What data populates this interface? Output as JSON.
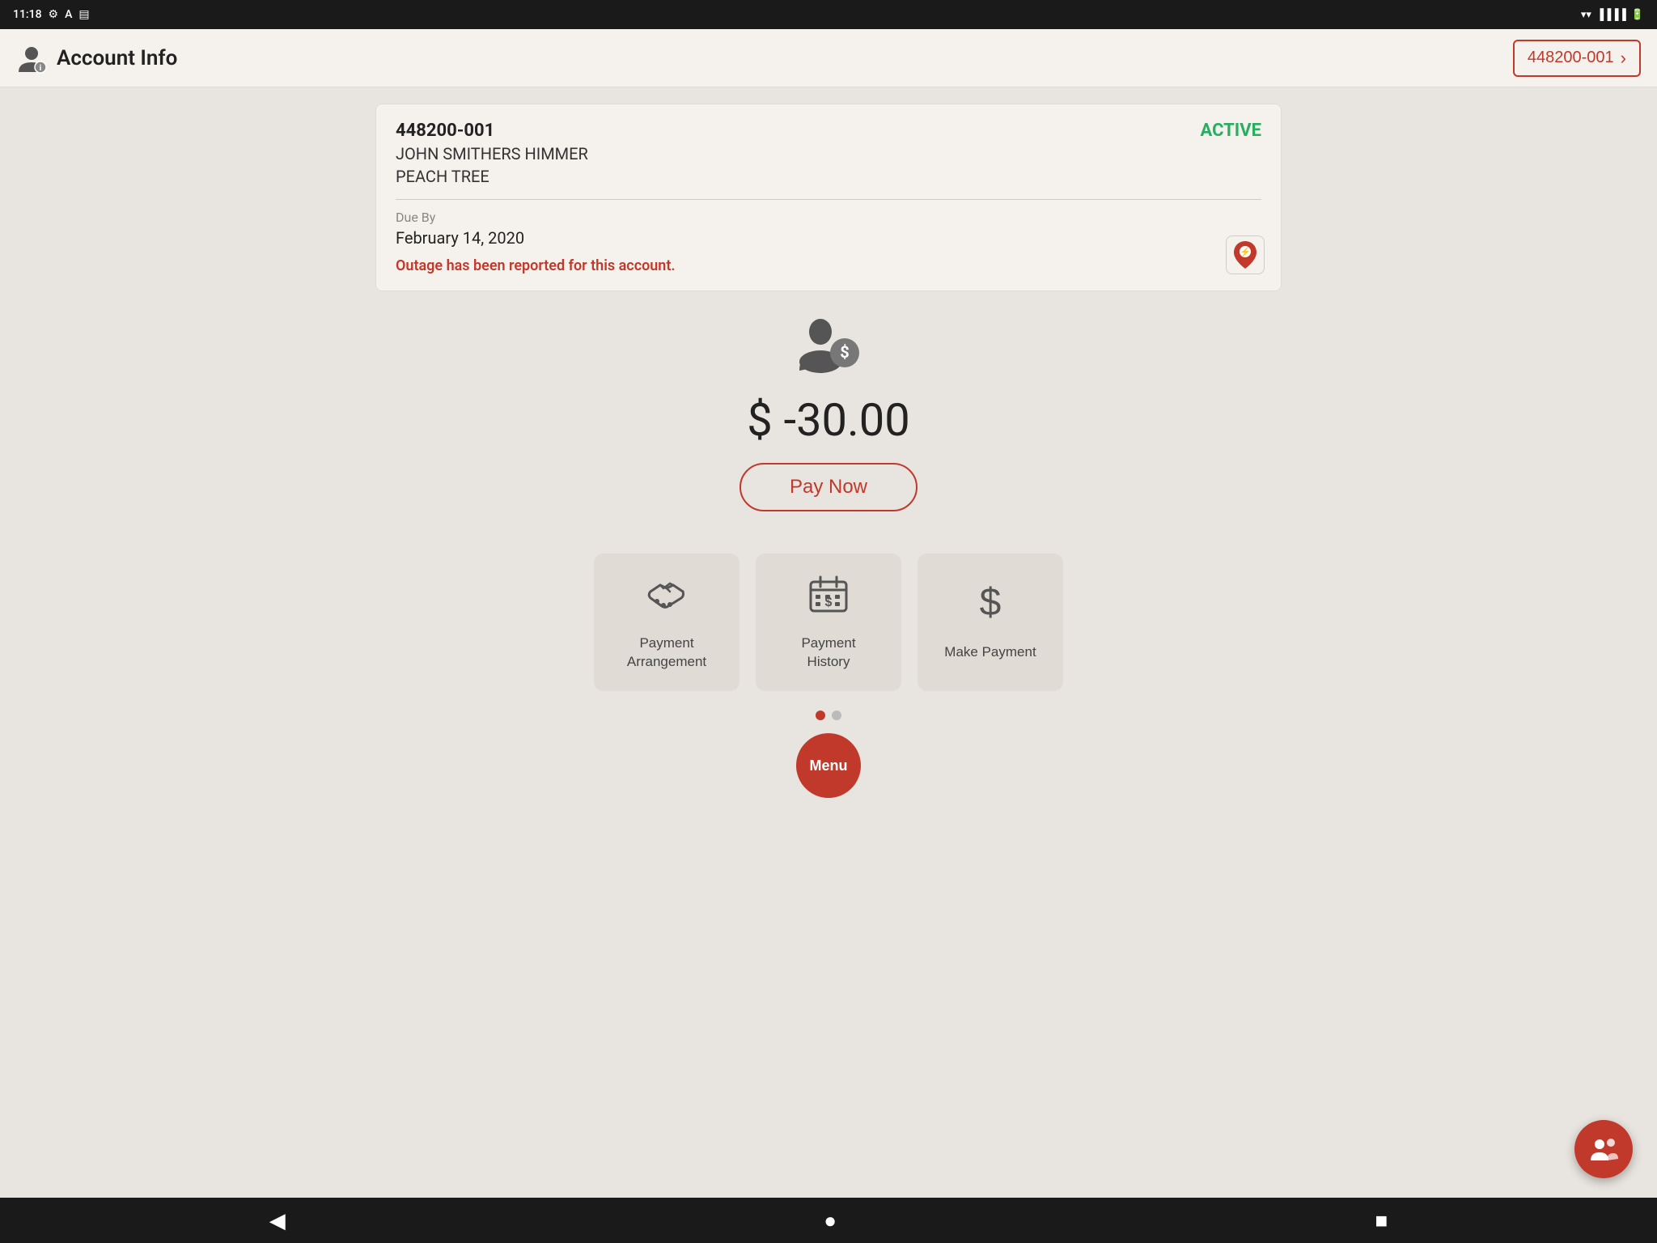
{
  "status_bar": {
    "time": "11:18",
    "icons": [
      "settings",
      "accessibility",
      "sim"
    ]
  },
  "nav": {
    "title": "Account Info",
    "account_number": "448200-001",
    "chevron": "›"
  },
  "account_card": {
    "account_number": "448200-001",
    "status": "ACTIVE",
    "name": "JOHN SMITHERS HIMMER",
    "location": "PEACH TREE",
    "due_label": "Due By",
    "due_date": "February 14, 2020",
    "outage_message": "Outage has been reported for this account."
  },
  "balance": {
    "amount": "$ -30.00",
    "pay_now_label": "Pay Now"
  },
  "tiles": [
    {
      "id": "payment-arrangement",
      "label": "Payment\nArrangement",
      "icon": "handshake"
    },
    {
      "id": "payment-history",
      "label": "Payment\nHistory",
      "icon": "calendar-dollar"
    },
    {
      "id": "make-payment",
      "label": "Make Payment",
      "icon": "dollar-sign"
    }
  ],
  "pagination": {
    "active_index": 0,
    "total": 2
  },
  "menu_label": "Menu",
  "fab_icon": "people",
  "bottom_nav": {
    "back": "◀",
    "home": "●",
    "square": "■"
  }
}
